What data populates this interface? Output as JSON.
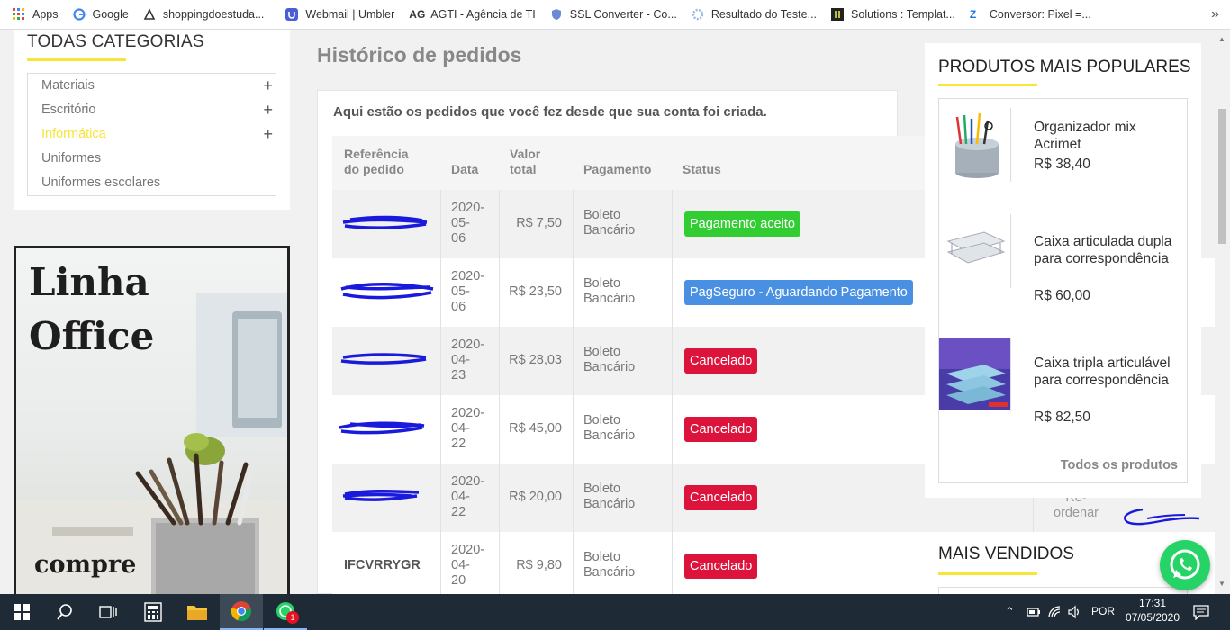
{
  "bookmarks": [
    {
      "label": "Apps",
      "icon": "apps-grid-icon"
    },
    {
      "label": "Google",
      "icon": "google-icon"
    },
    {
      "label": "shoppingdoestuda...",
      "icon": "bookmark-icon"
    },
    {
      "label": "Webmail | Umbler",
      "icon": "umbler-icon"
    },
    {
      "label": "AGTI - Agência de TI",
      "icon": "agti-icon"
    },
    {
      "label": "SSL Converter - Co...",
      "icon": "ssl-icon"
    },
    {
      "label": "Resultado do Teste...",
      "icon": "gear-icon"
    },
    {
      "label": "Solutions : Templat...",
      "icon": "template-icon"
    },
    {
      "label": "Conversor: Pixel =...",
      "icon": "z-icon"
    }
  ],
  "bookmarks_more": "»",
  "sidebar": {
    "title": "TODAS CATEGORIAS",
    "categories": [
      {
        "label": "Materiais",
        "expand": "+"
      },
      {
        "label": "Escritório",
        "expand": "+"
      },
      {
        "label": "Informática",
        "expand": "+"
      },
      {
        "label": "Uniformes"
      },
      {
        "label": "Uniformes escolares"
      }
    ],
    "banner": {
      "line1": "Linha",
      "line2": "Office",
      "bottom": "compre"
    }
  },
  "main": {
    "heading": "Histórico de pedidos",
    "intro": "Aqui estão os pedidos que você fez desde que sua conta foi criada.",
    "columns": {
      "ref1": "Referência",
      "ref2": "do pedido",
      "date": "Data",
      "total1": "Valor",
      "total2": "total",
      "payment": "Pagamento",
      "status": "Status"
    },
    "orders": [
      {
        "ref": "",
        "date": [
          "2020-",
          "05-",
          "06"
        ],
        "total": "R$ 7,50",
        "payment": [
          "Boleto",
          "Bancário"
        ],
        "status": "Pagamento aceito",
        "status_color": "#32cd32"
      },
      {
        "ref": "",
        "date": [
          "2020-",
          "05-",
          "06"
        ],
        "total": "R$ 23,50",
        "payment": [
          "Boleto",
          "Bancário"
        ],
        "status": "PagSeguro - Aguardando Pagamento",
        "status_color": "#4a90e2"
      },
      {
        "ref": "",
        "date": [
          "2020-",
          "04-",
          "23"
        ],
        "total": "R$ 28,03",
        "payment": [
          "Boleto",
          "Bancário"
        ],
        "status": "Cancelado",
        "status_color": "#dc143c"
      },
      {
        "ref": "",
        "date": [
          "2020-",
          "04-",
          "22"
        ],
        "total": "R$ 45,00",
        "payment": [
          "Boleto",
          "Bancário"
        ],
        "status": "Cancelado",
        "status_color": "#dc143c"
      },
      {
        "ref": "",
        "date": [
          "2020-",
          "04-",
          "22"
        ],
        "total": "R$ 20,00",
        "payment": [
          "Boleto",
          "Bancário"
        ],
        "status": "Cancelado",
        "status_color": "#dc143c"
      },
      {
        "ref": "IFCVRRYGR",
        "date": [
          "2020-",
          "04-",
          "20"
        ],
        "total": "R$ 9,80",
        "payment": [
          "Boleto",
          "Bancário"
        ],
        "status": "Cancelado",
        "status_color": "#dc143c"
      }
    ],
    "reorder": {
      "dash": "-",
      "line1": "Re-",
      "line2": "ordenar"
    }
  },
  "popular": {
    "title": "PRODUTOS MAIS POPULARES",
    "products": [
      {
        "name": "Organizador mix Acrimet",
        "price": "R$ 38,40"
      },
      {
        "name": "Caixa articulada dupla para correspondência",
        "price": "R$ 60,00"
      },
      {
        "name": "Caixa tripla articulável para correspondência",
        "price": "R$ 82,50"
      }
    ],
    "all_link": "Todos os produtos"
  },
  "best_sellers": {
    "title": "MAIS VENDIDOS"
  },
  "taskbar": {
    "lang": "POR",
    "time": "17:31",
    "date": "07/05/2020",
    "whatsapp_badge": "1"
  },
  "colors": {
    "accent_yellow": "#f7e53b",
    "taskbar": "#1e2a35",
    "whatsapp": "#25d366"
  }
}
